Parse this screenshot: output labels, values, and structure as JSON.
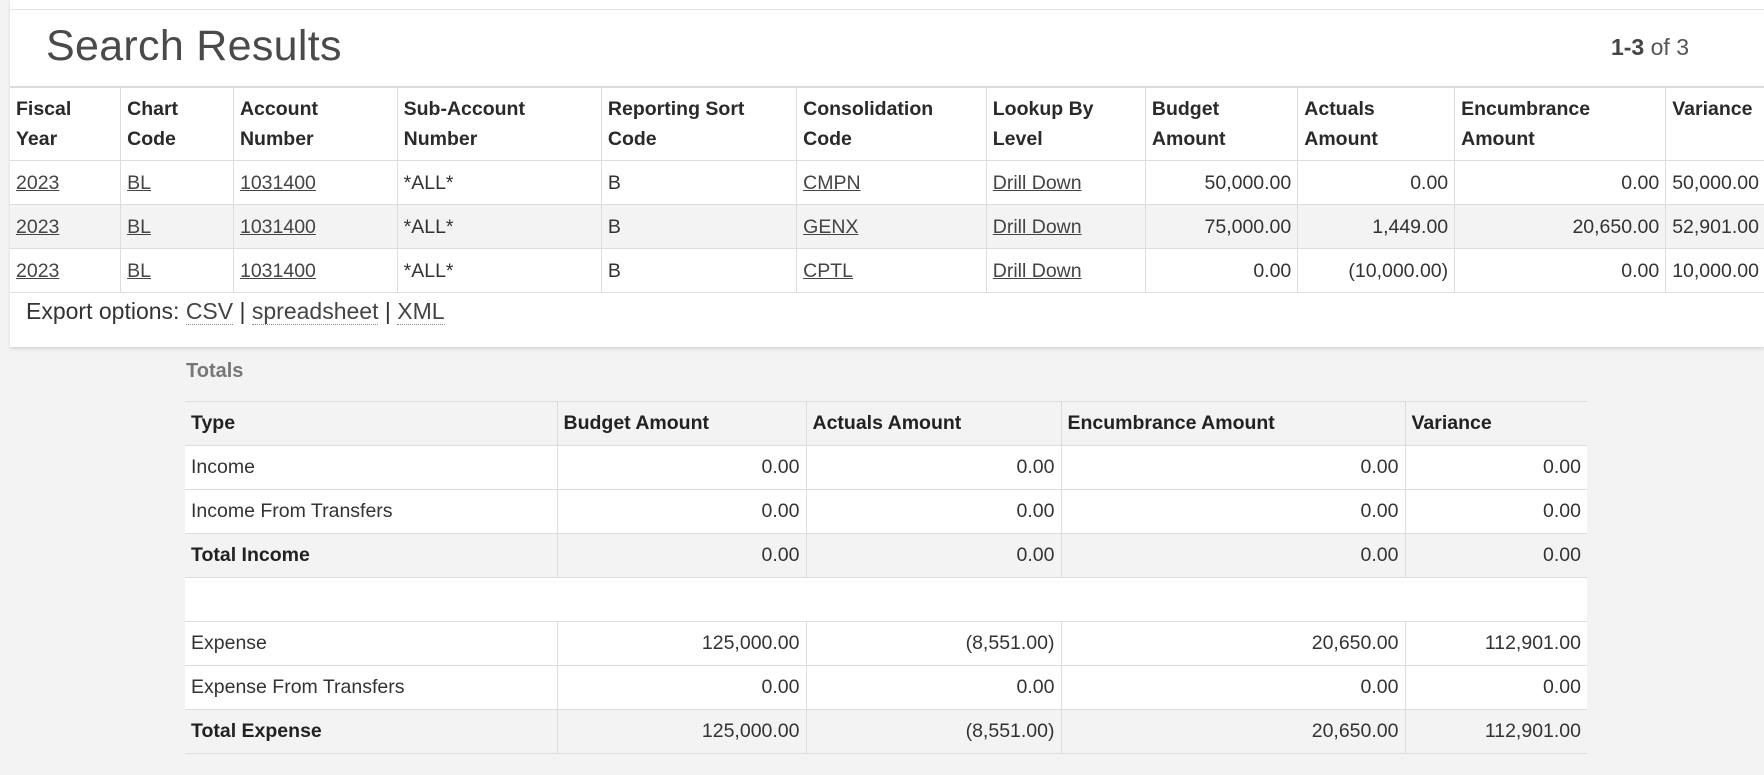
{
  "header": {
    "title": "Search Results",
    "pager_range": "1-3",
    "pager_of": " of 3"
  },
  "results": {
    "columns": [
      "Fiscal Year",
      "Chart Code",
      "Account Number",
      "Sub-Account Number",
      "Reporting Sort Code",
      "Consolidation Code",
      "Lookup By Level",
      "Budget Amount",
      "Actuals Amount",
      "Encumbrance Amount",
      "Variance"
    ],
    "rows": [
      {
        "fiscal_year": "2023",
        "chart_code": "BL",
        "account_number": "1031400",
        "sub_account": "*ALL*",
        "reporting_sort": "B",
        "consolidation": "CMPN",
        "lookup": "Drill Down",
        "budget": "50,000.00",
        "actuals": "0.00",
        "encumbrance": "0.00",
        "variance": "50,000.00"
      },
      {
        "fiscal_year": "2023",
        "chart_code": "BL",
        "account_number": "1031400",
        "sub_account": "*ALL*",
        "reporting_sort": "B",
        "consolidation": "GENX",
        "lookup": "Drill Down",
        "budget": "75,000.00",
        "actuals": "1,449.00",
        "encumbrance": "20,650.00",
        "variance": "52,901.00"
      },
      {
        "fiscal_year": "2023",
        "chart_code": "BL",
        "account_number": "1031400",
        "sub_account": "*ALL*",
        "reporting_sort": "B",
        "consolidation": "CPTL",
        "lookup": "Drill Down",
        "budget": "0.00",
        "actuals": "(10,000.00)",
        "encumbrance": "0.00",
        "variance": "10,000.00"
      }
    ]
  },
  "export": {
    "label": "Export options: ",
    "csv": "CSV",
    "spreadsheet": "spreadsheet",
    "xml": "XML",
    "separator": " | "
  },
  "totals": {
    "label": "Totals",
    "columns": [
      "Type",
      "Budget Amount",
      "Actuals Amount",
      "Encumbrance Amount",
      "Variance"
    ],
    "rows": [
      {
        "type": "Income",
        "budget": "0.00",
        "actuals": "0.00",
        "encumbrance": "0.00",
        "variance": "0.00"
      },
      {
        "type": "Income From Transfers",
        "budget": "0.00",
        "actuals": "0.00",
        "encumbrance": "0.00",
        "variance": "0.00"
      },
      {
        "type": "Total Income",
        "budget": "0.00",
        "actuals": "0.00",
        "encumbrance": "0.00",
        "variance": "0.00"
      },
      {
        "type": "Expense",
        "budget": "125,000.00",
        "actuals": "(8,551.00)",
        "encumbrance": "20,650.00",
        "variance": "112,901.00"
      },
      {
        "type": "Expense From Transfers",
        "budget": "0.00",
        "actuals": "0.00",
        "encumbrance": "0.00",
        "variance": "0.00"
      },
      {
        "type": "Total Expense",
        "budget": "125,000.00",
        "actuals": "(8,551.00)",
        "encumbrance": "20,650.00",
        "variance": "112,901.00"
      }
    ]
  }
}
